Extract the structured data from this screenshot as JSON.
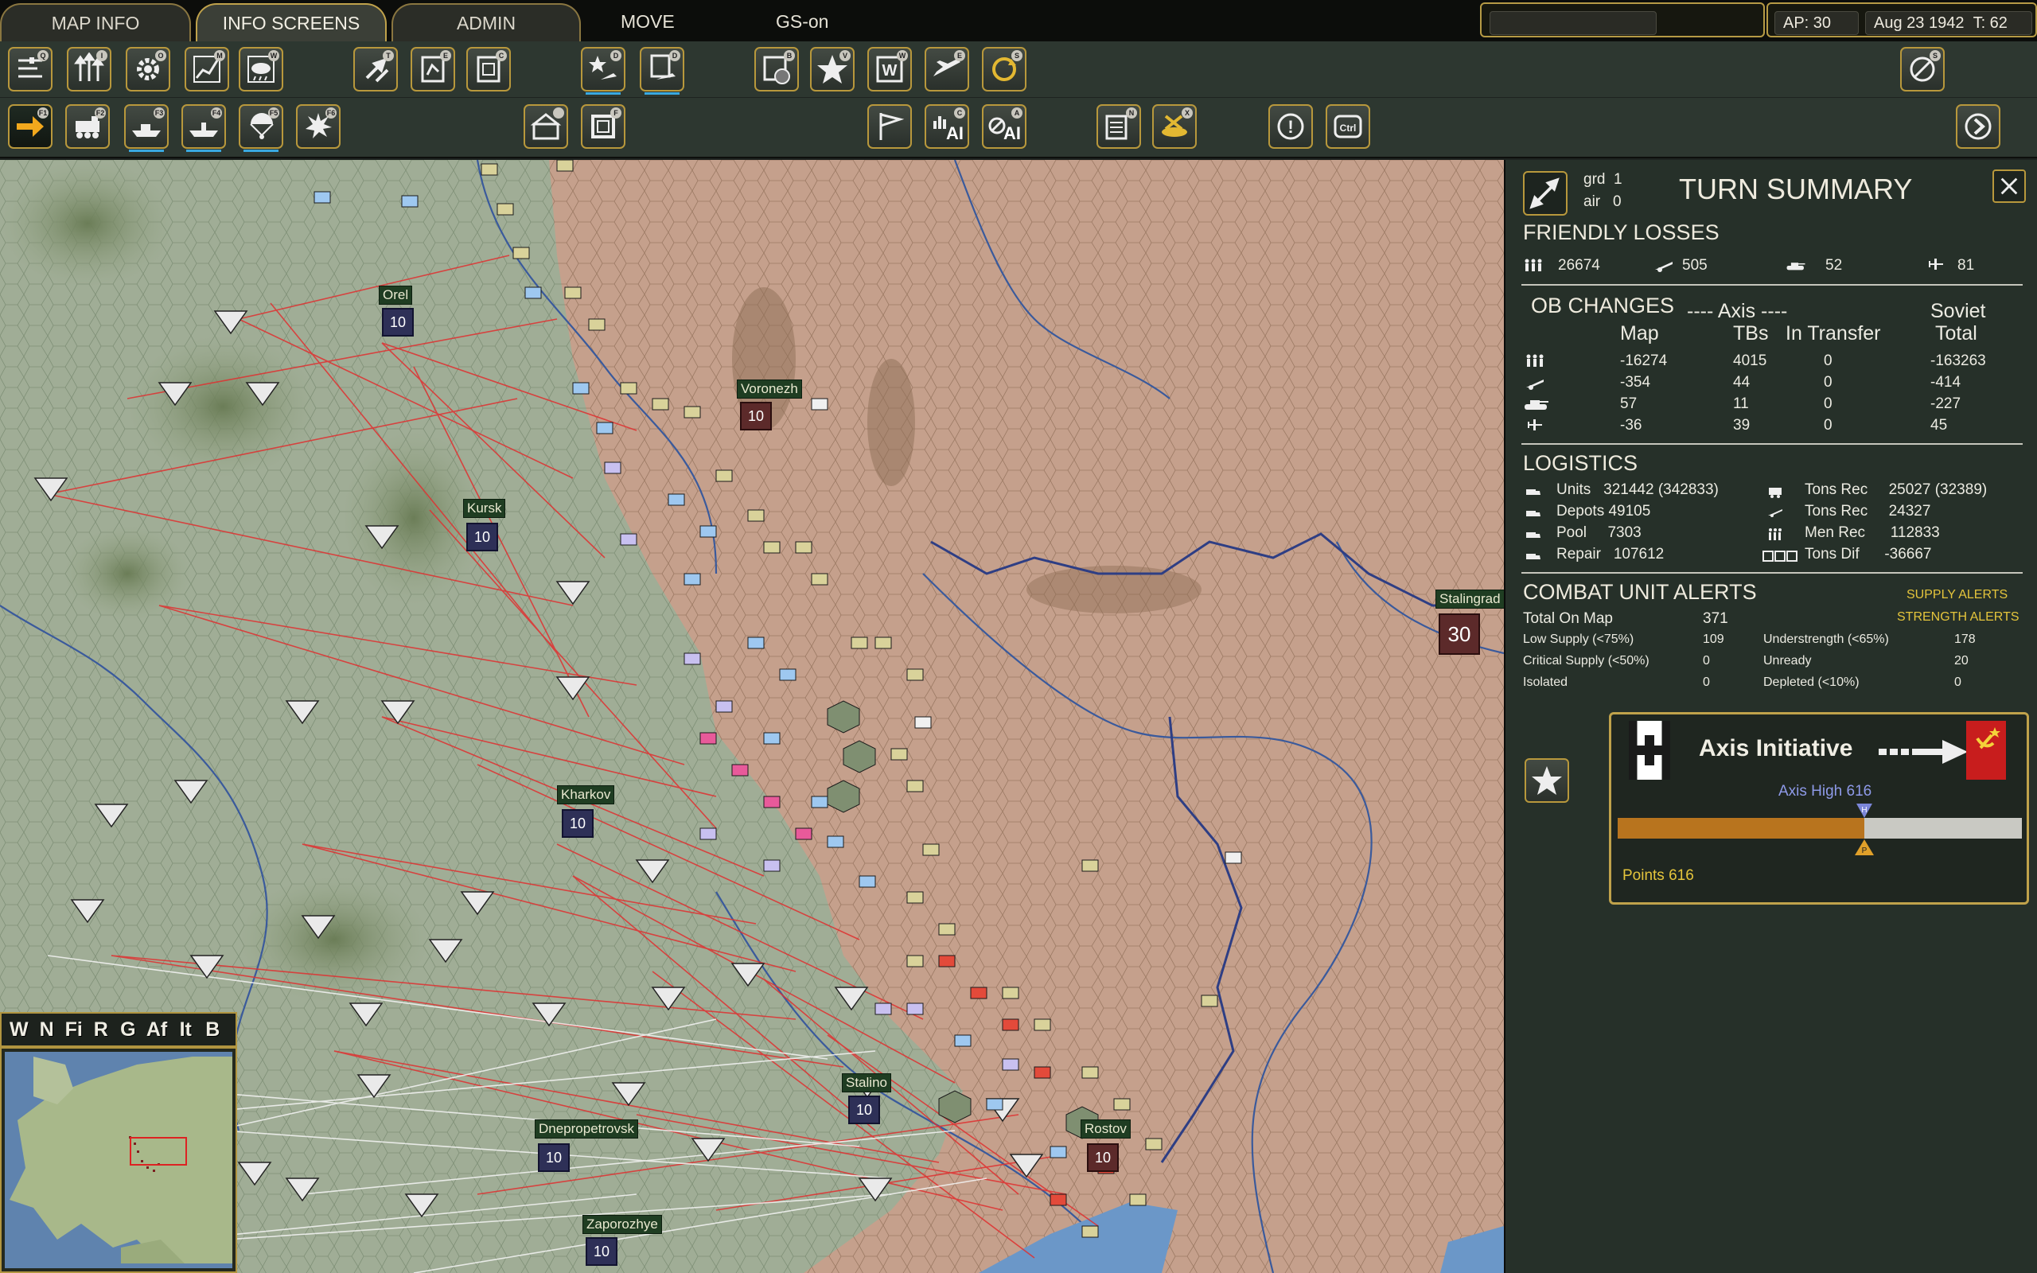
{
  "top_tabs": [
    {
      "label": "MAP INFO",
      "active": false
    },
    {
      "label": "INFO SCREENS",
      "active": true
    },
    {
      "label": "ADMIN",
      "active": false
    }
  ],
  "top_menu": {
    "move": "MOVE",
    "gs": "GS-on"
  },
  "status": {
    "ap": "AP: 30",
    "date": "Aug 23 1942",
    "turn": "T: 62"
  },
  "toolbar1": {
    "hotkeys": [
      "Q",
      "I",
      "O",
      "M",
      "W",
      "T",
      "E",
      "C",
      "D",
      "D",
      "B",
      "V",
      "W",
      "E",
      "S",
      "S"
    ]
  },
  "toolbar2": {
    "hotkeys": [
      "F1",
      "F2",
      "F3",
      "F4",
      "F5",
      "F6",
      "",
      "F",
      "",
      "C",
      "A",
      "N",
      "X",
      "",
      ""
    ],
    "ai_labels": [
      "AI",
      "AI"
    ],
    "ctrl_label": "Ctrl",
    "alert_label": "!"
  },
  "map": {
    "cities": [
      {
        "name": "Orel",
        "value": "10"
      },
      {
        "name": "Voronezh",
        "value": "10"
      },
      {
        "name": "Kursk",
        "value": "10"
      },
      {
        "name": "Kharkov",
        "value": "10"
      },
      {
        "name": "Stalino",
        "value": "10"
      },
      {
        "name": "Dnepropetrovsk",
        "value": "10"
      },
      {
        "name": "Rostov",
        "value": "10"
      },
      {
        "name": "Zaporozhye",
        "value": "10"
      },
      {
        "name": "Stalingrad",
        "value": "30"
      }
    ],
    "filters": [
      "W",
      "N",
      "Fi",
      "R",
      "G",
      "Af",
      "It",
      "B"
    ]
  },
  "panel": {
    "summary": {
      "grd_label": "grd",
      "grd_value": "1",
      "air_label": "air",
      "air_value": "0",
      "title": "TURN SUMMARY"
    },
    "friendly_losses": {
      "title": "FRIENDLY LOSSES",
      "men": "26674",
      "guns": "505",
      "tanks": "52",
      "aircraft": "81"
    },
    "ob_changes": {
      "title": "OB CHANGES",
      "axis_header": "---- Axis ----",
      "soviet_header": "Soviet",
      "col_map": "Map",
      "col_tbs": "TBs",
      "col_transfer": "In Transfer",
      "col_total": "Total",
      "rows": [
        {
          "map": "-16274",
          "tbs": "4015",
          "transfer": "0",
          "total": "-163263"
        },
        {
          "map": "-354",
          "tbs": "44",
          "transfer": "0",
          "total": "-414"
        },
        {
          "map": "57",
          "tbs": "11",
          "transfer": "0",
          "total": "-227"
        },
        {
          "map": "-36",
          "tbs": "39",
          "transfer": "0",
          "total": "45"
        }
      ]
    },
    "logistics": {
      "title": "LOGISTICS",
      "left": [
        {
          "label": "Units",
          "value": "321442 (342833)"
        },
        {
          "label": "Depots",
          "value": "49105"
        },
        {
          "label": "Pool",
          "value": "7303"
        },
        {
          "label": "Repair",
          "value": "107612"
        }
      ],
      "right": [
        {
          "label": "Tons Rec",
          "value": "25027 (32389)"
        },
        {
          "label": "Tons Rec",
          "value": "24327"
        },
        {
          "label": "Men Rec",
          "value": "112833"
        },
        {
          "label": "Tons Dif",
          "value": "-36667"
        }
      ]
    },
    "combat_alerts": {
      "title": "COMBAT UNIT ALERTS",
      "supply_link": "SUPPLY ALERTS",
      "strength_link": "STRENGTH ALERTS",
      "total_label": "Total On Map",
      "total_value": "371",
      "left": [
        {
          "label": "Low Supply  (<75%)",
          "value": "109"
        },
        {
          "label": "Critical Supply  (<50%)",
          "value": "0"
        },
        {
          "label": "Isolated",
          "value": "0"
        }
      ],
      "right": [
        {
          "label": "Understrength  (<65%)",
          "value": "178"
        },
        {
          "label": "Unready",
          "value": "20"
        },
        {
          "label": "Depleted  (<10%)",
          "value": "0"
        }
      ]
    },
    "initiative": {
      "title": "Axis Initiative",
      "high_label": "Axis High 616",
      "points_label": "Points 616",
      "fill_fraction": 0.61,
      "marker_h": "H",
      "marker_p": "P"
    }
  },
  "colors": {
    "accent": "#c0a24b",
    "axis_bar": "#b8741e",
    "panel": "#263029"
  }
}
